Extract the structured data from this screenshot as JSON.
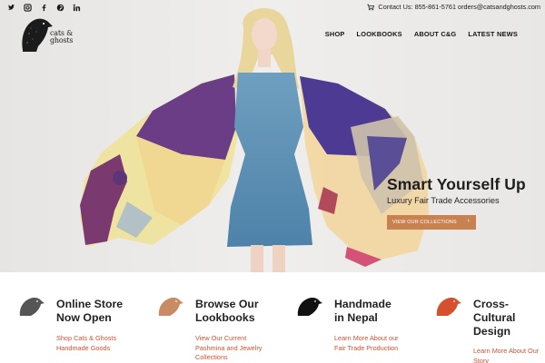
{
  "social": {
    "icons": [
      "twitter-icon",
      "instagram-icon",
      "facebook-icon",
      "pinterest-icon",
      "linkedin-icon"
    ]
  },
  "contact": {
    "icon": "cart-icon",
    "text": "Contact Us: 855-861-5761 orders@catsandghosts.com"
  },
  "logo": {
    "line1": "cats &",
    "line2": "ghosts"
  },
  "nav": {
    "items": [
      "SHOP",
      "LOOKBOOKS",
      "ABOUT C&G",
      "LATEST NEWS"
    ]
  },
  "hero": {
    "title": "Smart Yourself Up",
    "subtitle": "Luxury Fair Trade Accessories",
    "button_label": "VIEW OUR COLLECTIONS",
    "button_arrow": "›"
  },
  "features": [
    {
      "icon_color": "#555555",
      "title": "Online Store\nNow Open",
      "link": "Shop Cats & Ghosts\nHandmade Goods"
    },
    {
      "icon_color": "#c98b64",
      "title": "Browse Our\nLookbooks",
      "link": "View Our Current\nPashmina and Jewelry\nCollections"
    },
    {
      "icon_color": "#111111",
      "title": "Handmade\nin Nepal",
      "link": "Learn More About our\nFair Trade Production"
    },
    {
      "icon_color": "#d5502f",
      "title": "Cross-\nCultural\nDesign",
      "link": "Learn More About Our\nStory"
    }
  ],
  "colors": {
    "accent": "#d5502f",
    "button": "#c88250"
  }
}
